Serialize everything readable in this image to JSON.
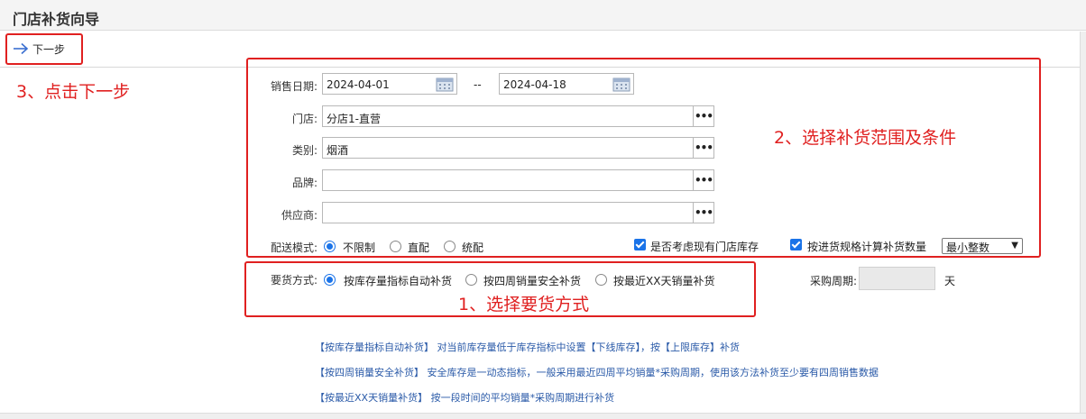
{
  "window": {
    "title": "门店补货向导"
  },
  "toolbar": {
    "next_label": "下一步"
  },
  "annotations": {
    "step3": "3、点击下一步",
    "step2": "2、选择补货范围及条件",
    "step1": "1、选择要货方式"
  },
  "form": {
    "sales_date_label": "销售日期:",
    "date_from": "2024-04-01",
    "date_sep": "--",
    "date_to": "2024-04-18",
    "store_label": "门店:",
    "store_value": "分店1-直营",
    "category_label": "类别:",
    "category_value": "烟酒",
    "brand_label": "品牌:",
    "brand_value": "",
    "supplier_label": "供应商:",
    "supplier_value": "",
    "delivery_label": "配送模式:",
    "delivery_options": [
      "不限制",
      "直配",
      "统配"
    ],
    "consider_stock_label": "是否考虑现有门店库存",
    "spec_calc_label": "按进货规格计算补货数量",
    "rounding_select": "最小整数",
    "order_method_label": "要货方式:",
    "order_methods": [
      "按库存量指标自动补货",
      "按四周销量安全补货",
      "按最近XX天销量补货"
    ],
    "purchase_cycle_label": "采购周期:",
    "purchase_cycle_unit": "天"
  },
  "notes": [
    "【按库存量指标自动补货】 对当前库存量低于库存指标中设置【下线库存】，按【上限库存】补货",
    "【按四周销量安全补货】 安全库存是一动态指标，一般采用最近四周平均销量*采购周期，使用该方法补货至少要有四周销售数据",
    "【按最近XX天销量补货】 按一段时间的平均销量*采购周期进行补货"
  ],
  "colors": {
    "annotation": "#e02020",
    "accent": "#1a73e8",
    "note": "#2a5aa8"
  }
}
